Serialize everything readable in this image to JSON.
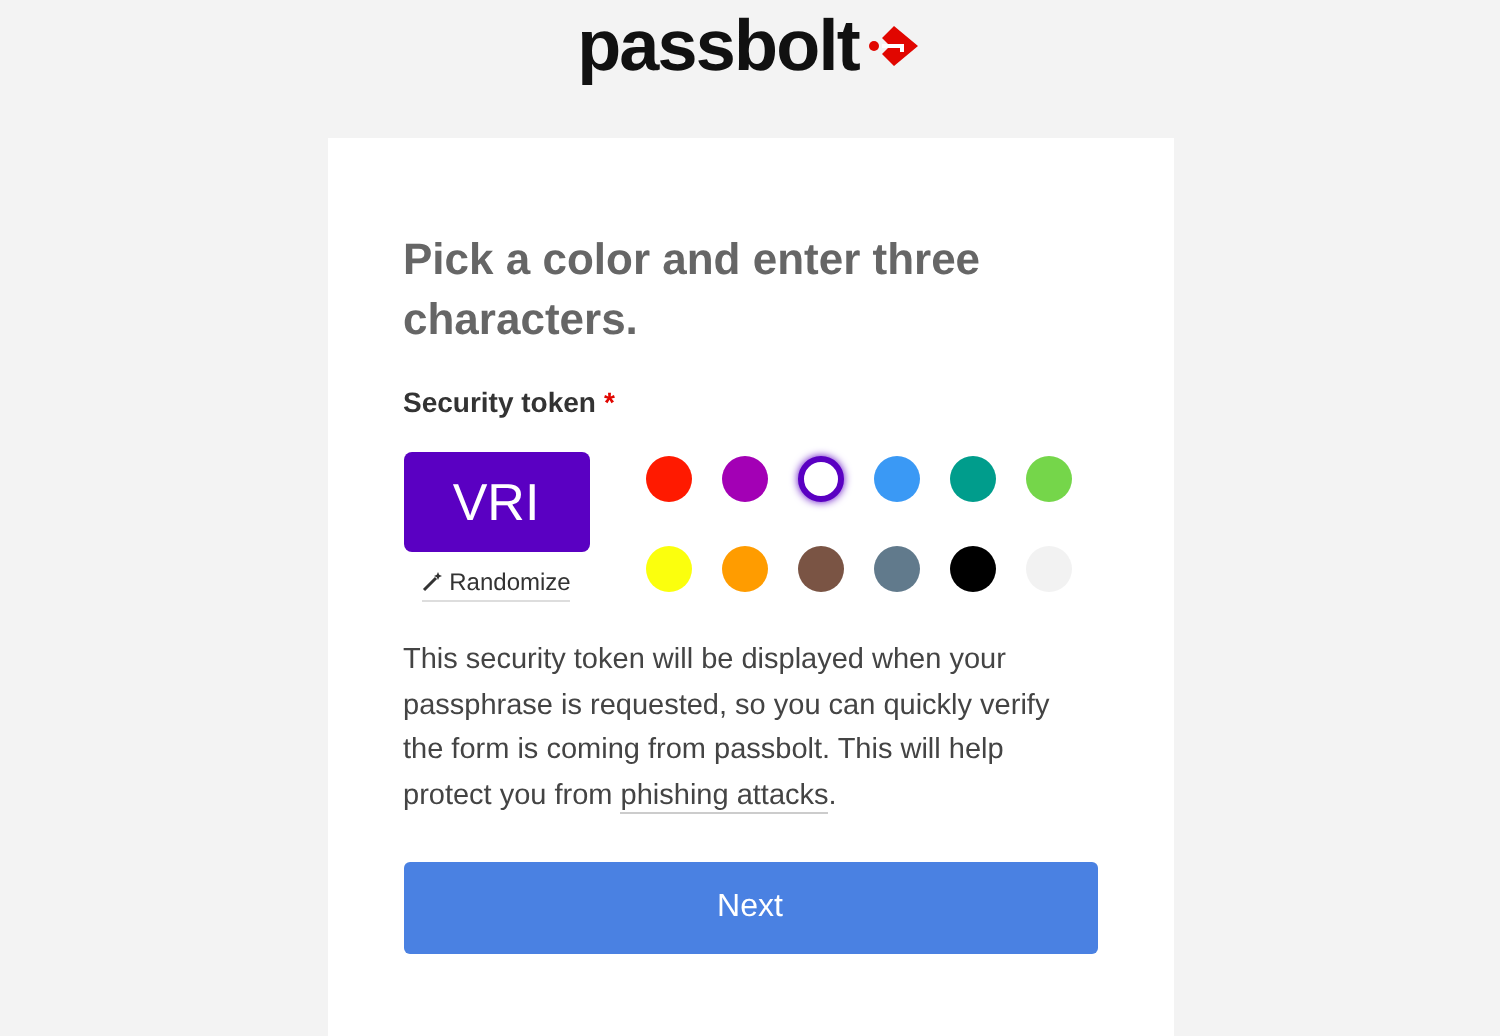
{
  "logo": {
    "text": "passbolt"
  },
  "heading": "Pick a color and enter three characters.",
  "token": {
    "label": "Security token",
    "required_mark": "*",
    "value": "VRI",
    "randomize": "Randomize"
  },
  "swatches": [
    {
      "color": "#ff1a00",
      "selected": false
    },
    {
      "color": "#a300b5",
      "selected": false
    },
    {
      "color": "#5a00c2",
      "selected": true
    },
    {
      "color": "#3a99f5",
      "selected": false
    },
    {
      "color": "#009d8c",
      "selected": false
    },
    {
      "color": "#75d64a",
      "selected": false
    },
    {
      "color": "#fbff0d",
      "selected": false
    },
    {
      "color": "#ff9c00",
      "selected": false
    },
    {
      "color": "#7a5444",
      "selected": false
    },
    {
      "color": "#617a8c",
      "selected": false
    },
    {
      "color": "#000000",
      "selected": false
    },
    {
      "color": "#f2f2f2",
      "selected": false
    }
  ],
  "description": {
    "before": "This security token will be displayed when your passphrase is requested, so you can quickly verify the form is coming from passbolt. This will help protect you from ",
    "link": "phishing attacks",
    "after": "."
  },
  "next_button": "Next"
}
